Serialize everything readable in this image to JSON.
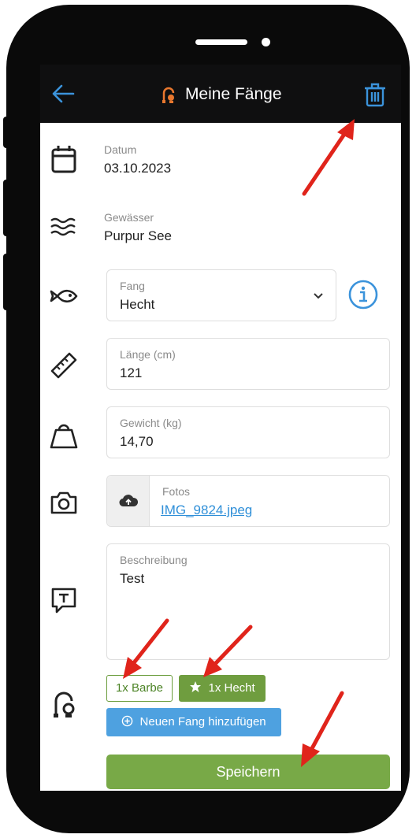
{
  "appbar": {
    "title": "Meine Fänge"
  },
  "fields": {
    "date": {
      "label": "Datum",
      "value": "03.10.2023"
    },
    "water": {
      "label": "Gewässer",
      "value": "Purpur See"
    },
    "catch": {
      "label": "Fang",
      "value": "Hecht"
    },
    "length": {
      "label": "Länge (cm)",
      "value": "121"
    },
    "weight": {
      "label": "Gewicht (kg)",
      "value": "14,70"
    },
    "photos": {
      "label": "Fotos",
      "value": "IMG_9824.jpeg"
    },
    "description": {
      "label": "Beschreibung",
      "value": "Test"
    }
  },
  "catches": [
    {
      "label": "1x Barbe",
      "selected": false
    },
    {
      "label": "1x Hecht",
      "selected": true
    }
  ],
  "actions": {
    "add_catch": "Neuen Fang hinzufügen",
    "save": "Speichern"
  },
  "icons": [
    "back-arrow-icon",
    "fishing-reel-icon",
    "trash-icon",
    "calendar-icon",
    "waves-icon",
    "fish-icon",
    "ruler-icon",
    "weight-icon",
    "camera-icon",
    "text-icon",
    "info-icon",
    "chevron-down-icon",
    "cloud-upload-icon",
    "star-icon",
    "plus-circle-icon"
  ],
  "colors": {
    "accent_blue": "#2f8fd8",
    "brand_orange": "#e8772e",
    "save_green": "#78a947",
    "chip_green": "#6f9d3f",
    "annotation_red": "#e0241b"
  }
}
